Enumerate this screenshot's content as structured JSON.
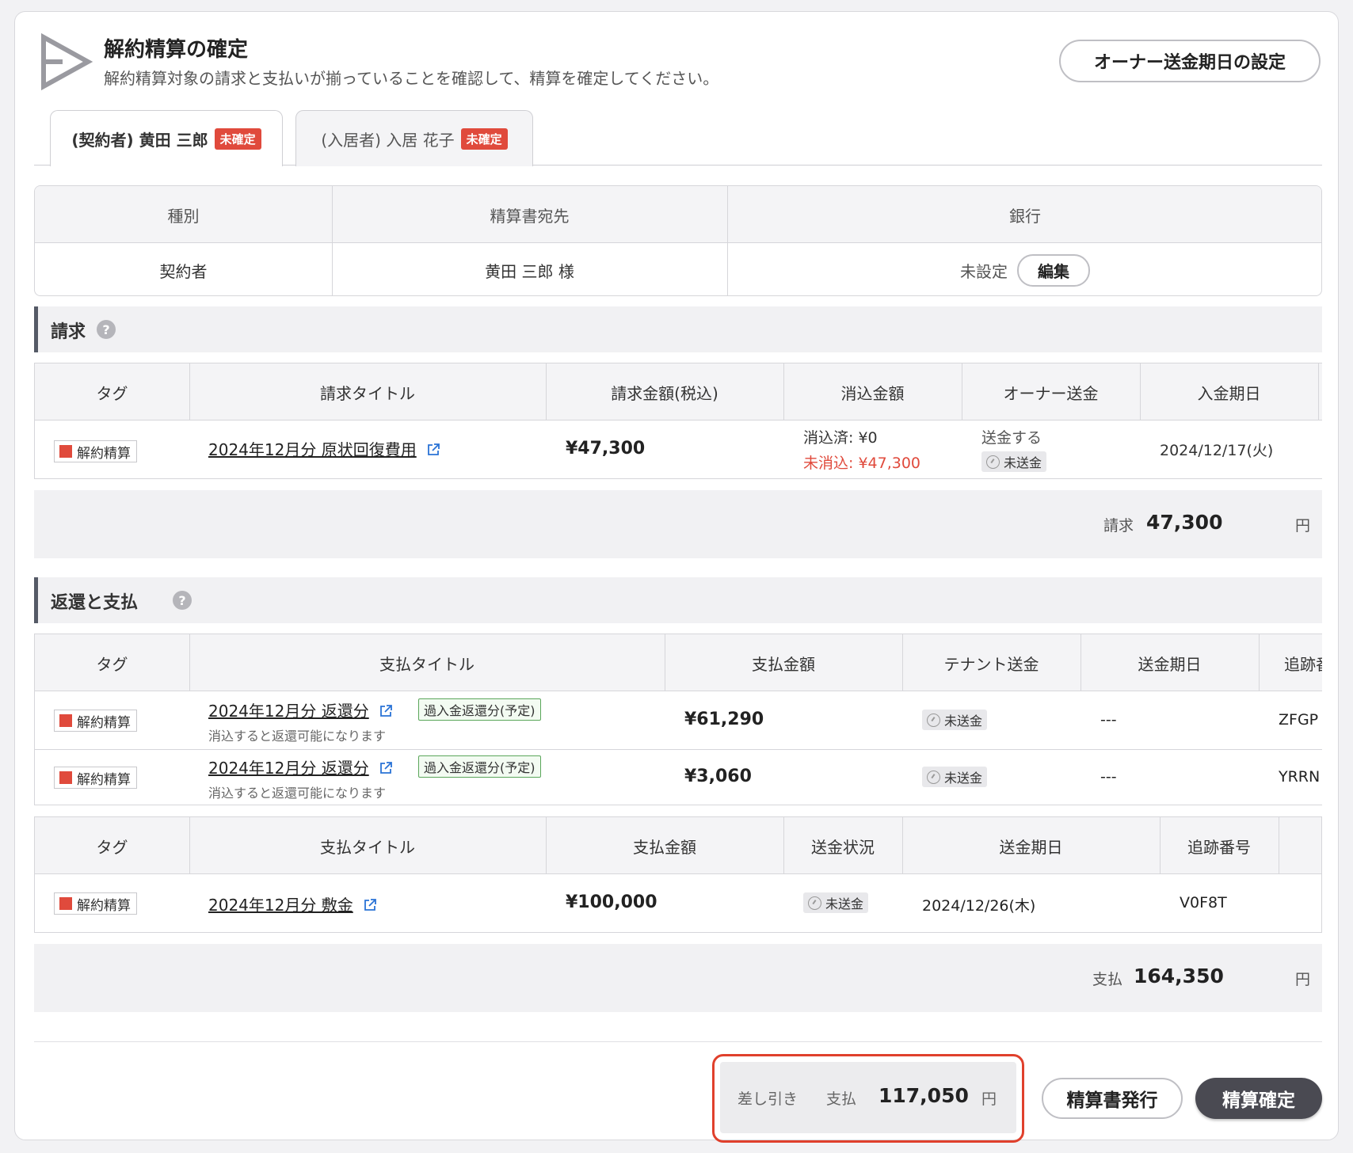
{
  "header": {
    "title": "解約精算の確定",
    "subtitle": "解約精算対象の請求と支払いが揃っていることを確認して、精算を確定してください。",
    "owner_button": "オーナー送金期日の設定"
  },
  "tabs": [
    {
      "label": "(契約者) 黄田 三郎",
      "badge": "未確定"
    },
    {
      "label": "(入居者) 入居 花子",
      "badge": "未確定"
    }
  ],
  "info": {
    "headers": [
      "種別",
      "精算書宛先",
      "銀行"
    ],
    "type": "契約者",
    "recipient": "黄田 三郎 様",
    "bank": "未設定",
    "edit_label": "編集"
  },
  "billing": {
    "title": "請求",
    "headers": [
      "タグ",
      "請求タイトル",
      "請求金額(税込)",
      "消込金額",
      "オーナー送金",
      "入金期日"
    ],
    "row": {
      "tag": "解約精算",
      "title": "2024年12月分 原状回復費用",
      "amount": "¥47,300",
      "cleared": "消込済: ¥0",
      "uncleared": "未消込: ¥47,300",
      "owner_send": "送金する",
      "owner_status": "未送金",
      "due": "2024/12/17(火)"
    },
    "total_label": "請求",
    "total_value": "47,300",
    "yen": "円"
  },
  "refund": {
    "title": "返還と支払",
    "headers": [
      "タグ",
      "支払タイトル",
      "支払金額",
      "テナント送金",
      "送金期日",
      "追跡番"
    ],
    "rows": [
      {
        "tag": "解約精算",
        "title": "2024年12月分 返還分",
        "badge": "過入金返還分(予定)",
        "note": "消込すると返還可能になります",
        "amount": "¥61,290",
        "status": "未送金",
        "date": "---",
        "tracking": "ZFGP"
      },
      {
        "tag": "解約精算",
        "title": "2024年12月分 返還分",
        "badge": "過入金返還分(予定)",
        "note": "消込すると返還可能になります",
        "amount": "¥3,060",
        "status": "未送金",
        "date": "---",
        "tracking": "YRRN"
      }
    ],
    "headers2": [
      "タグ",
      "支払タイトル",
      "支払金額",
      "送金状況",
      "送金期日",
      "追跡番号"
    ],
    "row2": {
      "tag": "解約精算",
      "title": "2024年12月分 敷金",
      "amount": "¥100,000",
      "status": "未送金",
      "date": "2024/12/26(木)",
      "tracking": "V0F8T"
    },
    "total_label": "支払",
    "total_value": "164,350",
    "yen": "円"
  },
  "footer": {
    "diff_label": "差し引き",
    "diff_type": "支払",
    "diff_value": "117,050",
    "yen": "円",
    "issue_button": "精算書発行",
    "confirm_button": "精算確定"
  },
  "colors": {
    "accent_red": "#e04a3c",
    "highlight_outline": "#e0402c",
    "dark_button": "#4a4a52"
  }
}
